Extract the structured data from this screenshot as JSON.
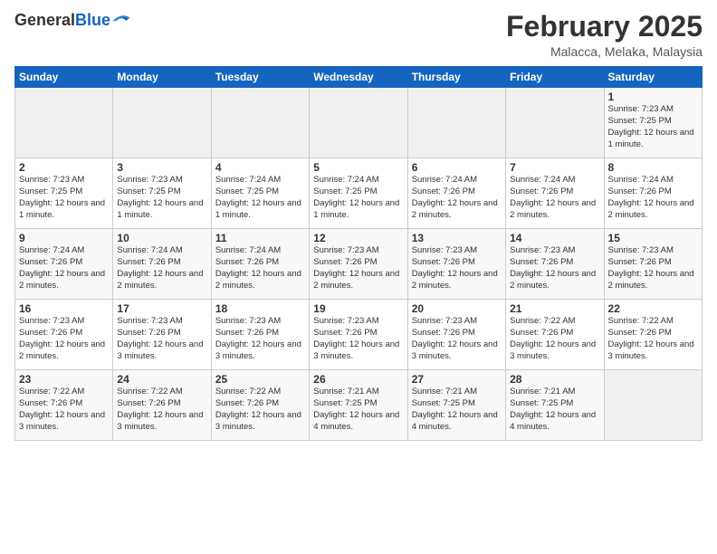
{
  "logo": {
    "general": "General",
    "blue": "Blue"
  },
  "title": "February 2025",
  "location": "Malacca, Melaka, Malaysia",
  "days_of_week": [
    "Sunday",
    "Monday",
    "Tuesday",
    "Wednesday",
    "Thursday",
    "Friday",
    "Saturday"
  ],
  "weeks": [
    [
      {
        "day": "",
        "info": ""
      },
      {
        "day": "",
        "info": ""
      },
      {
        "day": "",
        "info": ""
      },
      {
        "day": "",
        "info": ""
      },
      {
        "day": "",
        "info": ""
      },
      {
        "day": "",
        "info": ""
      },
      {
        "day": "1",
        "info": "Sunrise: 7:23 AM\nSunset: 7:25 PM\nDaylight: 12 hours and 1 minute."
      }
    ],
    [
      {
        "day": "2",
        "info": "Sunrise: 7:23 AM\nSunset: 7:25 PM\nDaylight: 12 hours and 1 minute."
      },
      {
        "day": "3",
        "info": "Sunrise: 7:23 AM\nSunset: 7:25 PM\nDaylight: 12 hours and 1 minute."
      },
      {
        "day": "4",
        "info": "Sunrise: 7:24 AM\nSunset: 7:25 PM\nDaylight: 12 hours and 1 minute."
      },
      {
        "day": "5",
        "info": "Sunrise: 7:24 AM\nSunset: 7:25 PM\nDaylight: 12 hours and 1 minute."
      },
      {
        "day": "6",
        "info": "Sunrise: 7:24 AM\nSunset: 7:26 PM\nDaylight: 12 hours and 2 minutes."
      },
      {
        "day": "7",
        "info": "Sunrise: 7:24 AM\nSunset: 7:26 PM\nDaylight: 12 hours and 2 minutes."
      },
      {
        "day": "8",
        "info": "Sunrise: 7:24 AM\nSunset: 7:26 PM\nDaylight: 12 hours and 2 minutes."
      }
    ],
    [
      {
        "day": "9",
        "info": "Sunrise: 7:24 AM\nSunset: 7:26 PM\nDaylight: 12 hours and 2 minutes."
      },
      {
        "day": "10",
        "info": "Sunrise: 7:24 AM\nSunset: 7:26 PM\nDaylight: 12 hours and 2 minutes."
      },
      {
        "day": "11",
        "info": "Sunrise: 7:24 AM\nSunset: 7:26 PM\nDaylight: 12 hours and 2 minutes."
      },
      {
        "day": "12",
        "info": "Sunrise: 7:23 AM\nSunset: 7:26 PM\nDaylight: 12 hours and 2 minutes."
      },
      {
        "day": "13",
        "info": "Sunrise: 7:23 AM\nSunset: 7:26 PM\nDaylight: 12 hours and 2 minutes."
      },
      {
        "day": "14",
        "info": "Sunrise: 7:23 AM\nSunset: 7:26 PM\nDaylight: 12 hours and 2 minutes."
      },
      {
        "day": "15",
        "info": "Sunrise: 7:23 AM\nSunset: 7:26 PM\nDaylight: 12 hours and 2 minutes."
      }
    ],
    [
      {
        "day": "16",
        "info": "Sunrise: 7:23 AM\nSunset: 7:26 PM\nDaylight: 12 hours and 2 minutes."
      },
      {
        "day": "17",
        "info": "Sunrise: 7:23 AM\nSunset: 7:26 PM\nDaylight: 12 hours and 3 minutes."
      },
      {
        "day": "18",
        "info": "Sunrise: 7:23 AM\nSunset: 7:26 PM\nDaylight: 12 hours and 3 minutes."
      },
      {
        "day": "19",
        "info": "Sunrise: 7:23 AM\nSunset: 7:26 PM\nDaylight: 12 hours and 3 minutes."
      },
      {
        "day": "20",
        "info": "Sunrise: 7:23 AM\nSunset: 7:26 PM\nDaylight: 12 hours and 3 minutes."
      },
      {
        "day": "21",
        "info": "Sunrise: 7:22 AM\nSunset: 7:26 PM\nDaylight: 12 hours and 3 minutes."
      },
      {
        "day": "22",
        "info": "Sunrise: 7:22 AM\nSunset: 7:26 PM\nDaylight: 12 hours and 3 minutes."
      }
    ],
    [
      {
        "day": "23",
        "info": "Sunrise: 7:22 AM\nSunset: 7:26 PM\nDaylight: 12 hours and 3 minutes."
      },
      {
        "day": "24",
        "info": "Sunrise: 7:22 AM\nSunset: 7:26 PM\nDaylight: 12 hours and 3 minutes."
      },
      {
        "day": "25",
        "info": "Sunrise: 7:22 AM\nSunset: 7:26 PM\nDaylight: 12 hours and 3 minutes."
      },
      {
        "day": "26",
        "info": "Sunrise: 7:21 AM\nSunset: 7:25 PM\nDaylight: 12 hours and 4 minutes."
      },
      {
        "day": "27",
        "info": "Sunrise: 7:21 AM\nSunset: 7:25 PM\nDaylight: 12 hours and 4 minutes."
      },
      {
        "day": "28",
        "info": "Sunrise: 7:21 AM\nSunset: 7:25 PM\nDaylight: 12 hours and 4 minutes."
      },
      {
        "day": "",
        "info": ""
      }
    ]
  ]
}
